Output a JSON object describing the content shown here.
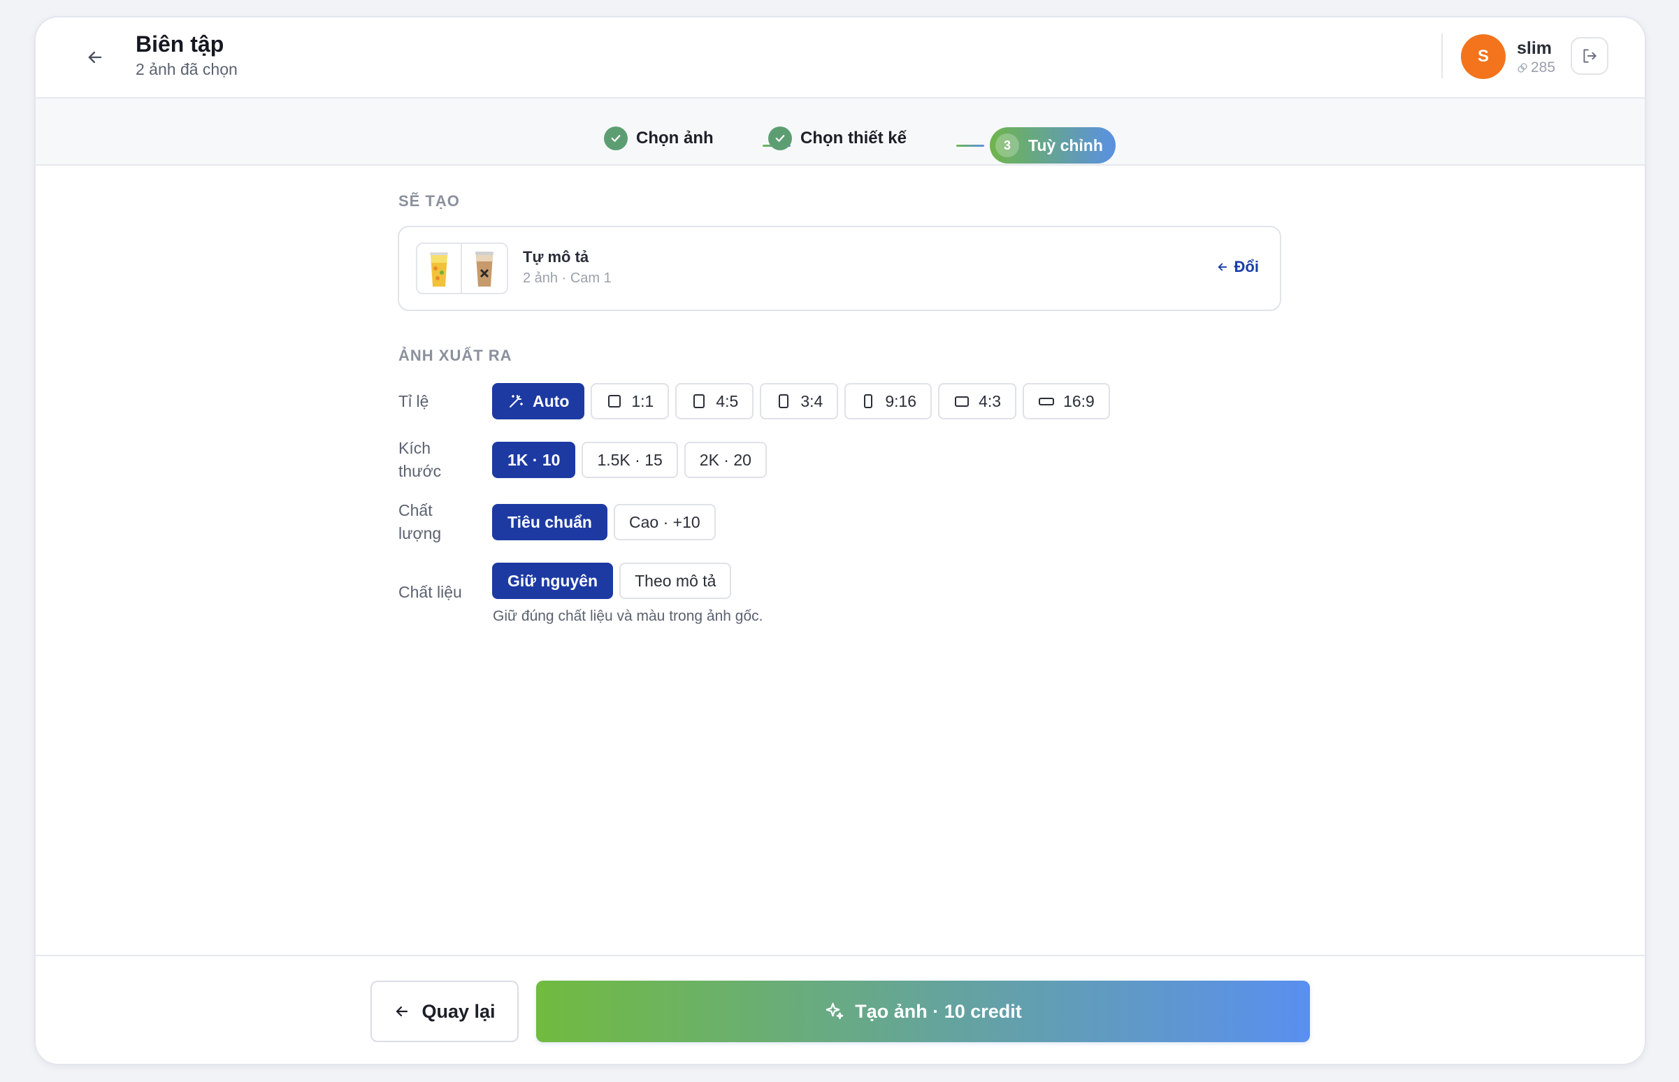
{
  "header": {
    "title": "Biên tập",
    "subtitle": "2 ảnh đã chọn",
    "avatar_initial": "S",
    "username": "slim",
    "credits": "285"
  },
  "stepper": {
    "steps": [
      {
        "label": "Chọn ảnh",
        "state": "done"
      },
      {
        "label": "Chọn thiết kế",
        "state": "done"
      },
      {
        "label": "Tuỳ chỉnh",
        "number": "3",
        "state": "active"
      }
    ]
  },
  "design": {
    "section_label": "SẼ TẠO",
    "name": "Tự mô tả",
    "meta": "2 ảnh · Cam 1",
    "change_label": "Đổi"
  },
  "output": {
    "section_label": "ẢNH XUẤT RA",
    "ratio": {
      "label": "Tỉ lệ",
      "options": [
        {
          "label": "Auto",
          "icon": "magic-wand-icon",
          "selected": true
        },
        {
          "label": "1:1",
          "icon": "square-icon"
        },
        {
          "label": "4:5",
          "icon": "portrait-4-5-icon"
        },
        {
          "label": "3:4",
          "icon": "portrait-3-4-icon"
        },
        {
          "label": "9:16",
          "icon": "portrait-9-16-icon"
        },
        {
          "label": "4:3",
          "icon": "landscape-4-3-icon"
        },
        {
          "label": "16:9",
          "icon": "landscape-16-9-icon"
        }
      ]
    },
    "size": {
      "label_line1": "Kích",
      "label_line2": "thước",
      "options": [
        {
          "label": "1K · 10",
          "selected": true
        },
        {
          "label": "1.5K · 15"
        },
        {
          "label": "2K · 20"
        }
      ]
    },
    "quality": {
      "label_line1": "Chất",
      "label_line2": "lượng",
      "options": [
        {
          "label": "Tiêu chuẩn",
          "selected": true
        },
        {
          "label": "Cao · +10"
        }
      ]
    },
    "material": {
      "label": "Chất liệu",
      "options": [
        {
          "label": "Giữ nguyên",
          "selected": true
        },
        {
          "label": "Theo mô tả"
        }
      ],
      "hint": "Giữ đúng chất liệu và màu trong ảnh gốc."
    }
  },
  "footer": {
    "back_label": "Quay lại",
    "create_label": "Tạo ảnh · 10 credit"
  },
  "colors": {
    "accent": "#1d3aa3",
    "avatar": "#f3741c",
    "gradient_start": "#71bb3f",
    "gradient_end": "#5a8ff0"
  }
}
